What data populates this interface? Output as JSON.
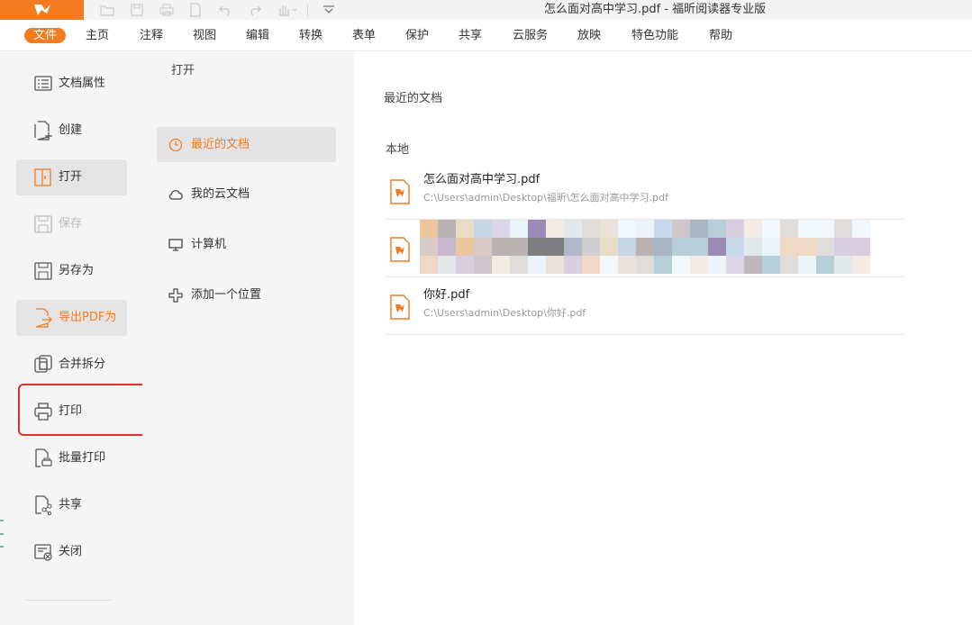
{
  "titlebar": {
    "title": "怎么面对高中学习.pdf - 福昕阅读器专业版",
    "accent": "#f47b20",
    "quick_access_icons": [
      "open-icon",
      "save-icon",
      "print-icon",
      "new-icon",
      "undo-icon",
      "redo-icon",
      "hand-icon",
      "dropdown-icon"
    ]
  },
  "menubar": {
    "items": [
      "文件",
      "主页",
      "注释",
      "视图",
      "编辑",
      "转换",
      "表单",
      "保护",
      "共享",
      "云服务",
      "放映",
      "特色功能",
      "帮助"
    ],
    "active": "文件"
  },
  "leftnav": {
    "items": [
      {
        "label": "文档属性",
        "icon": "properties-icon"
      },
      {
        "label": "创建",
        "icon": "create-icon"
      },
      {
        "label": "打开",
        "icon": "open-icon",
        "selected": true
      },
      {
        "label": "保存",
        "icon": "save-icon",
        "disabled": true
      },
      {
        "label": "另存为",
        "icon": "save-as-icon"
      },
      {
        "label": "导出PDF为",
        "icon": "export-icon",
        "highlight": true
      },
      {
        "label": "合并拆分",
        "icon": "merge-split-icon"
      },
      {
        "label": "打印",
        "icon": "print-icon",
        "annotated": true
      },
      {
        "label": "批量打印",
        "icon": "batch-print-icon"
      },
      {
        "label": "共享",
        "icon": "share-icon"
      },
      {
        "label": "关闭",
        "icon": "close-icon"
      }
    ]
  },
  "middle": {
    "title": "打开",
    "items": [
      {
        "label": "最近的文档",
        "icon": "clock-icon",
        "selected": true
      },
      {
        "label": "我的云文档",
        "icon": "cloud-icon"
      },
      {
        "label": "计算机",
        "icon": "computer-icon"
      },
      {
        "label": "添加一个位置",
        "icon": "add-icon"
      }
    ]
  },
  "content": {
    "heading": "最近的文档",
    "local_heading": "本地",
    "files": [
      {
        "name": "怎么面对高中学习.pdf",
        "path": "C:\\Users\\admin\\Desktop\\福昕\\怎么面对高中学习.pdf"
      },
      {
        "name": "",
        "path": "",
        "obscured": true
      },
      {
        "name": "你好.pdf",
        "path": "C:\\Users\\admin\\Desktop\\你好.pdf"
      }
    ]
  }
}
